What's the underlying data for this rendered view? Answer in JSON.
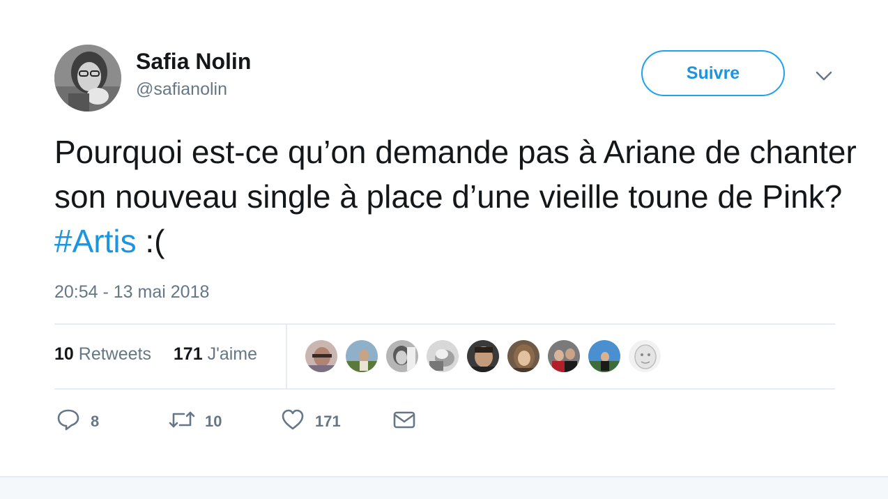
{
  "author": {
    "name": "Safia Nolin",
    "handle": "@safianolin"
  },
  "follow_button": {
    "label": "Suivre"
  },
  "tweet": {
    "text_before_hashtag": "Pourquoi est-ce qu’on demande pas à Ariane de chanter son nouveau single à place d’une vieille toune de Pink? ",
    "hashtag": "#Artis",
    "text_after_hashtag": " :(",
    "timestamp": "20:54 - 13 mai 2018"
  },
  "stats": {
    "retweets_count": "10",
    "retweets_label": "Retweets",
    "likes_count": "171",
    "likes_label": "J'aime"
  },
  "liker_avatars": [
    "avatar-1",
    "avatar-2",
    "avatar-3",
    "avatar-4",
    "avatar-5",
    "avatar-6",
    "avatar-7",
    "avatar-8",
    "avatar-9"
  ],
  "actions": {
    "replies": "8",
    "retweets": "10",
    "likes": "171"
  },
  "colors": {
    "accent": "#1da1f2",
    "link": "#1b95e0",
    "text": "#14171a",
    "secondary": "#657786",
    "divider": "#e6ecf0"
  },
  "icons": [
    "chevron-down-icon",
    "reply-icon",
    "retweet-icon",
    "heart-icon",
    "envelope-icon"
  ]
}
